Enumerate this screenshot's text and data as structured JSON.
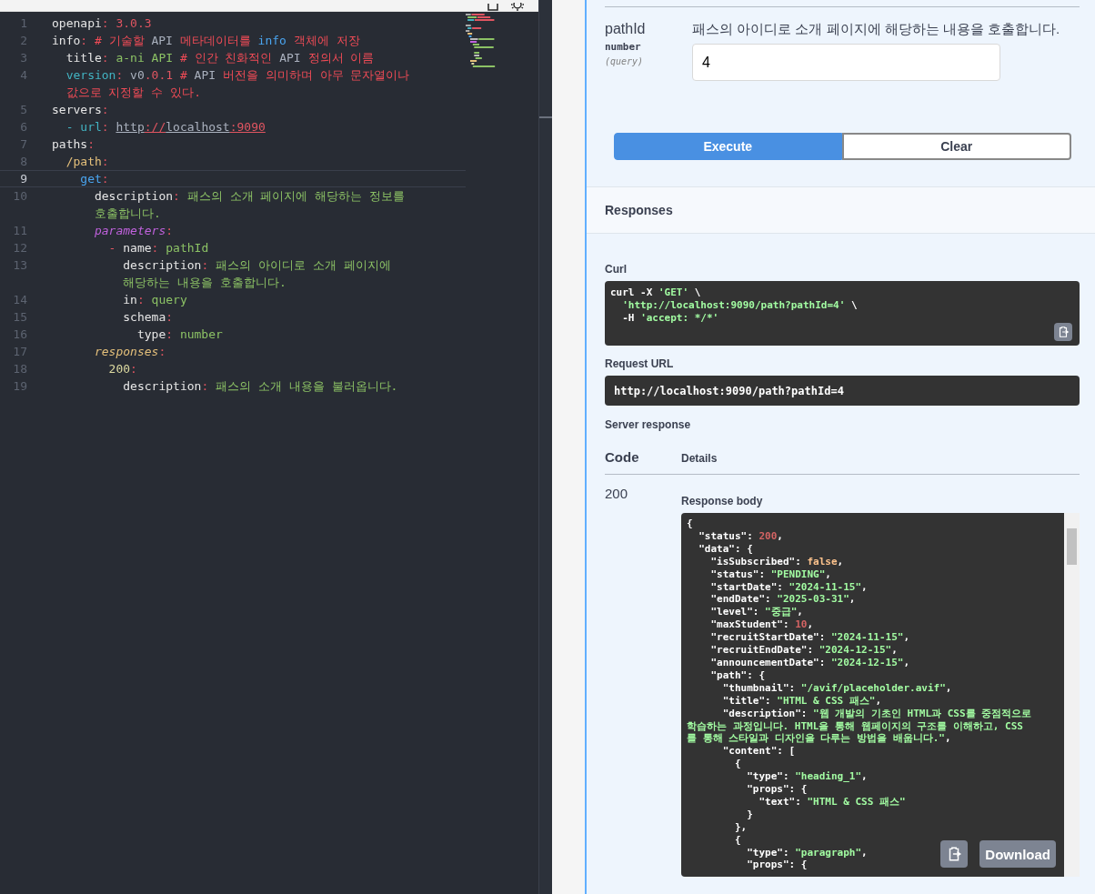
{
  "editor": {
    "lines": [
      {
        "number": "1",
        "current": false,
        "tokens": [
          {
            "text": "openapi",
            "kind": "key"
          },
          {
            "text": ":",
            "kind": "punct"
          },
          {
            "text": " 3.0.3",
            "kind": "num"
          }
        ]
      },
      {
        "number": "2",
        "current": false,
        "tokens": [
          {
            "text": "info",
            "kind": "key"
          },
          {
            "text": ":",
            "kind": "punct"
          },
          {
            "text": " # 기술할 ",
            "kind": "comment"
          },
          {
            "text": "API",
            "kind": "plain"
          },
          {
            "text": " 메타데이터를 ",
            "kind": "comment"
          },
          {
            "text": "info",
            "kind": "method"
          },
          {
            "text": " 객체에 저장",
            "kind": "comment"
          }
        ]
      },
      {
        "number": "3",
        "current": false,
        "tokens": [
          {
            "text": "  title",
            "kind": "key"
          },
          {
            "text": ":",
            "kind": "punct"
          },
          {
            "text": " a-ni API",
            "kind": "str"
          },
          {
            "text": " # 인간 친화적인 ",
            "kind": "comment"
          },
          {
            "text": "API",
            "kind": "plain"
          },
          {
            "text": " 정의서 이름",
            "kind": "comment"
          }
        ]
      },
      {
        "number": "4",
        "current": false,
        "tokens": [
          {
            "text": "  version",
            "kind": "cyan"
          },
          {
            "text": ":",
            "kind": "punct"
          },
          {
            "text": " v0",
            "kind": "plain"
          },
          {
            "text": ".0.1",
            "kind": "num"
          },
          {
            "text": " # ",
            "kind": "comment"
          },
          {
            "text": "API",
            "kind": "plain"
          },
          {
            "text": " 버전을 의미하며 아무 문자열이나",
            "kind": "comment"
          }
        ],
        "wrap": [
          {
            "text": "  값으로 지정할 수 있다.",
            "kind": "comment"
          }
        ]
      },
      {
        "number": "5",
        "current": false,
        "tokens": [
          {
            "text": "servers",
            "kind": "key"
          },
          {
            "text": ":",
            "kind": "punct"
          }
        ]
      },
      {
        "number": "6",
        "current": false,
        "tokens": [
          {
            "text": "  - url",
            "kind": "cyan"
          },
          {
            "text": ": ",
            "kind": "punct"
          },
          {
            "text": "http",
            "kind": "link"
          },
          {
            "text": "://",
            "kind": "linkred"
          },
          {
            "text": "localhost",
            "kind": "link"
          },
          {
            "text": ":9090",
            "kind": "linkred"
          }
        ]
      },
      {
        "number": "7",
        "current": false,
        "tokens": [
          {
            "text": "paths",
            "kind": "key"
          },
          {
            "text": ":",
            "kind": "punct"
          }
        ]
      },
      {
        "number": "8",
        "current": false,
        "tokens": [
          {
            "text": "  /path",
            "kind": "path"
          },
          {
            "text": ":",
            "kind": "punct"
          }
        ]
      },
      {
        "number": "9",
        "current": true,
        "tokens": [
          {
            "text": "    get",
            "kind": "method"
          },
          {
            "text": ":",
            "kind": "punct"
          }
        ]
      },
      {
        "number": "10",
        "current": false,
        "tokens": [
          {
            "text": "      description",
            "kind": "key"
          },
          {
            "text": ":",
            "kind": "punct"
          },
          {
            "text": " 패스의 소개 페이지에 해당하는 정보를",
            "kind": "str"
          }
        ],
        "wrap": [
          {
            "text": "      호출합니다.",
            "kind": "str"
          }
        ]
      },
      {
        "number": "11",
        "current": false,
        "tokens": [
          {
            "text": "      parameters",
            "kind": "param"
          },
          {
            "text": ":",
            "kind": "punct"
          }
        ]
      },
      {
        "number": "12",
        "current": false,
        "tokens": [
          {
            "text": "        - ",
            "kind": "punct"
          },
          {
            "text": "name",
            "kind": "key"
          },
          {
            "text": ":",
            "kind": "punct"
          },
          {
            "text": " pathId",
            "kind": "str"
          }
        ]
      },
      {
        "number": "13",
        "current": false,
        "tokens": [
          {
            "text": "          description",
            "kind": "key"
          },
          {
            "text": ":",
            "kind": "punct"
          },
          {
            "text": " 패스의 아이디로 소개 페이지에",
            "kind": "str"
          }
        ],
        "wrap": [
          {
            "text": "          해당하는 내용을 호출합니다.",
            "kind": "str"
          }
        ]
      },
      {
        "number": "14",
        "current": false,
        "tokens": [
          {
            "text": "          in",
            "kind": "key"
          },
          {
            "text": ":",
            "kind": "punct"
          },
          {
            "text": " query",
            "kind": "str"
          }
        ]
      },
      {
        "number": "15",
        "current": false,
        "tokens": [
          {
            "text": "          schema",
            "kind": "key"
          },
          {
            "text": ":",
            "kind": "punct"
          }
        ]
      },
      {
        "number": "16",
        "current": false,
        "tokens": [
          {
            "text": "            type",
            "kind": "key"
          },
          {
            "text": ":",
            "kind": "punct"
          },
          {
            "text": " number",
            "kind": "str"
          }
        ]
      },
      {
        "number": "17",
        "current": false,
        "tokens": [
          {
            "text": "      responses",
            "kind": "resp"
          },
          {
            "text": ":",
            "kind": "punct"
          }
        ]
      },
      {
        "number": "18",
        "current": false,
        "tokens": [
          {
            "text": "        200",
            "kind": "numkey"
          },
          {
            "text": ":",
            "kind": "punct"
          }
        ]
      },
      {
        "number": "19",
        "current": false,
        "tokens": [
          {
            "text": "          description",
            "kind": "key"
          },
          {
            "text": ":",
            "kind": "punct"
          },
          {
            "text": " 패스의 소개 내용을 불러옵니다.",
            "kind": "str"
          }
        ]
      }
    ]
  },
  "swagger": {
    "parameter": {
      "name": "pathId",
      "type": "number",
      "location": "(query)",
      "description": "패스의 아이디로 소개 페이지에 해당하는 내용을 호출합니다.",
      "value": "4"
    },
    "buttons": [
      {
        "label": "Execute",
        "kind": "primary"
      },
      {
        "label": "Clear",
        "kind": "secondary"
      }
    ],
    "responses_title": "Responses",
    "curl_label": "Curl",
    "curl": [
      [
        {
          "text": "curl -X ",
          "kind": "p"
        },
        {
          "text": "'GET'",
          "kind": "s"
        },
        {
          "text": " \\",
          "kind": "p"
        }
      ],
      [
        {
          "text": "  'http://localhost:9090/path?pathId=4'",
          "kind": "s"
        },
        {
          "text": " \\",
          "kind": "p"
        }
      ],
      [
        {
          "text": "  -H ",
          "kind": "p"
        },
        {
          "text": "'accept: */*'",
          "kind": "s"
        }
      ]
    ],
    "request_url_label": "Request URL",
    "request_url": "http://localhost:9090/path?pathId=4",
    "server_response_label": "Server response",
    "columns": [
      "Code",
      "Details"
    ],
    "code": "200",
    "response_body_label": "Response body",
    "response_body": [
      [
        {
          "text": "{",
          "kind": "p"
        }
      ],
      [
        {
          "text": "  \"status\": ",
          "kind": "p"
        },
        {
          "text": "200",
          "kind": "n"
        },
        {
          "text": ",",
          "kind": "p"
        }
      ],
      [
        {
          "text": "  \"data\": {",
          "kind": "p"
        }
      ],
      [
        {
          "text": "    \"isSubscribed\": ",
          "kind": "p"
        },
        {
          "text": "false",
          "kind": "b"
        },
        {
          "text": ",",
          "kind": "p"
        }
      ],
      [
        {
          "text": "    \"status\": ",
          "kind": "p"
        },
        {
          "text": "\"PENDING\"",
          "kind": "s"
        },
        {
          "text": ",",
          "kind": "p"
        }
      ],
      [
        {
          "text": "    \"startDate\": ",
          "kind": "p"
        },
        {
          "text": "\"2024-11-15\"",
          "kind": "s"
        },
        {
          "text": ",",
          "kind": "p"
        }
      ],
      [
        {
          "text": "    \"endDate\": ",
          "kind": "p"
        },
        {
          "text": "\"2025-03-31\"",
          "kind": "s"
        },
        {
          "text": ",",
          "kind": "p"
        }
      ],
      [
        {
          "text": "    \"level\": ",
          "kind": "p"
        },
        {
          "text": "\"중급\"",
          "kind": "s"
        },
        {
          "text": ",",
          "kind": "p"
        }
      ],
      [
        {
          "text": "    \"maxStudent\": ",
          "kind": "p"
        },
        {
          "text": "10",
          "kind": "n"
        },
        {
          "text": ",",
          "kind": "p"
        }
      ],
      [
        {
          "text": "    \"recruitStartDate\": ",
          "kind": "p"
        },
        {
          "text": "\"2024-11-15\"",
          "kind": "s"
        },
        {
          "text": ",",
          "kind": "p"
        }
      ],
      [
        {
          "text": "    \"recruitEndDate\": ",
          "kind": "p"
        },
        {
          "text": "\"2024-12-15\"",
          "kind": "s"
        },
        {
          "text": ",",
          "kind": "p"
        }
      ],
      [
        {
          "text": "    \"announcementDate\": ",
          "kind": "p"
        },
        {
          "text": "\"2024-12-15\"",
          "kind": "s"
        },
        {
          "text": ",",
          "kind": "p"
        }
      ],
      [
        {
          "text": "    \"path\": {",
          "kind": "p"
        }
      ],
      [
        {
          "text": "      \"thumbnail\": ",
          "kind": "p"
        },
        {
          "text": "\"/avif/placeholder.avif\"",
          "kind": "s"
        },
        {
          "text": ",",
          "kind": "p"
        }
      ],
      [
        {
          "text": "      \"title\": ",
          "kind": "p"
        },
        {
          "text": "\"HTML & CSS 패스\"",
          "kind": "s"
        },
        {
          "text": ",",
          "kind": "p"
        }
      ],
      [
        {
          "text": "      \"description\": ",
          "kind": "p"
        },
        {
          "text": "\"웹 개발의 기초인 HTML과 CSS를 중점적으로",
          "kind": "s"
        }
      ],
      [
        {
          "text": "학습하는 과정입니다. HTML을 통해 웹페이지의 구조를 이해하고, CSS",
          "kind": "s"
        }
      ],
      [
        {
          "text": "를 통해 스타일과 디자인을 다루는 방법을 배웁니다.\"",
          "kind": "s"
        },
        {
          "text": ",",
          "kind": "p"
        }
      ],
      [
        {
          "text": "      \"content\": [",
          "kind": "p"
        }
      ],
      [
        {
          "text": "        {",
          "kind": "p"
        }
      ],
      [
        {
          "text": "          \"type\": ",
          "kind": "p"
        },
        {
          "text": "\"heading_1\"",
          "kind": "s"
        },
        {
          "text": ",",
          "kind": "p"
        }
      ],
      [
        {
          "text": "          \"props\": {",
          "kind": "p"
        }
      ],
      [
        {
          "text": "            \"text\": ",
          "kind": "p"
        },
        {
          "text": "\"HTML & CSS 패스\"",
          "kind": "s"
        }
      ],
      [
        {
          "text": "          }",
          "kind": "p"
        }
      ],
      [
        {
          "text": "        },",
          "kind": "p"
        }
      ],
      [
        {
          "text": "        {",
          "kind": "p"
        }
      ],
      [
        {
          "text": "          \"type\": ",
          "kind": "p"
        },
        {
          "text": "\"paragraph\"",
          "kind": "s"
        },
        {
          "text": ",",
          "kind": "p"
        }
      ],
      [
        {
          "text": "          \"props\": {",
          "kind": "p"
        }
      ]
    ],
    "download_label": "Download"
  }
}
